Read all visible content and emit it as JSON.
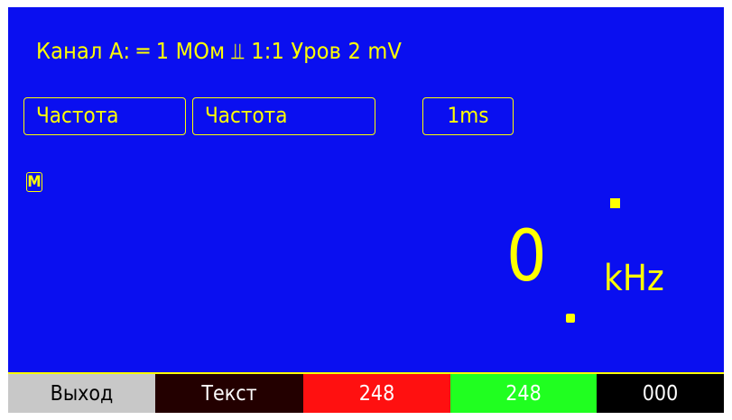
{
  "header": {
    "channel_info": "Канал А: ═ 1 МОм  ⫫ 1:1 Уров 2 mV"
  },
  "buttons": {
    "mode1": "Частота",
    "mode2": "Частота",
    "timebase": "1ms"
  },
  "badge": {
    "m_label": "M"
  },
  "reading": {
    "value": "0",
    "unit": "kHz"
  },
  "softkeys": [
    {
      "label": "Выход",
      "color": "#c8c8c8"
    },
    {
      "label": "Текст",
      "color": "#230000"
    },
    {
      "label": "248",
      "color": "#ff1010"
    },
    {
      "label": "248",
      "color": "#20ff20"
    },
    {
      "label": "000",
      "color": "#000000"
    }
  ],
  "colors": {
    "screen_bg": "#0a0ff0",
    "accent": "#ffff00"
  }
}
